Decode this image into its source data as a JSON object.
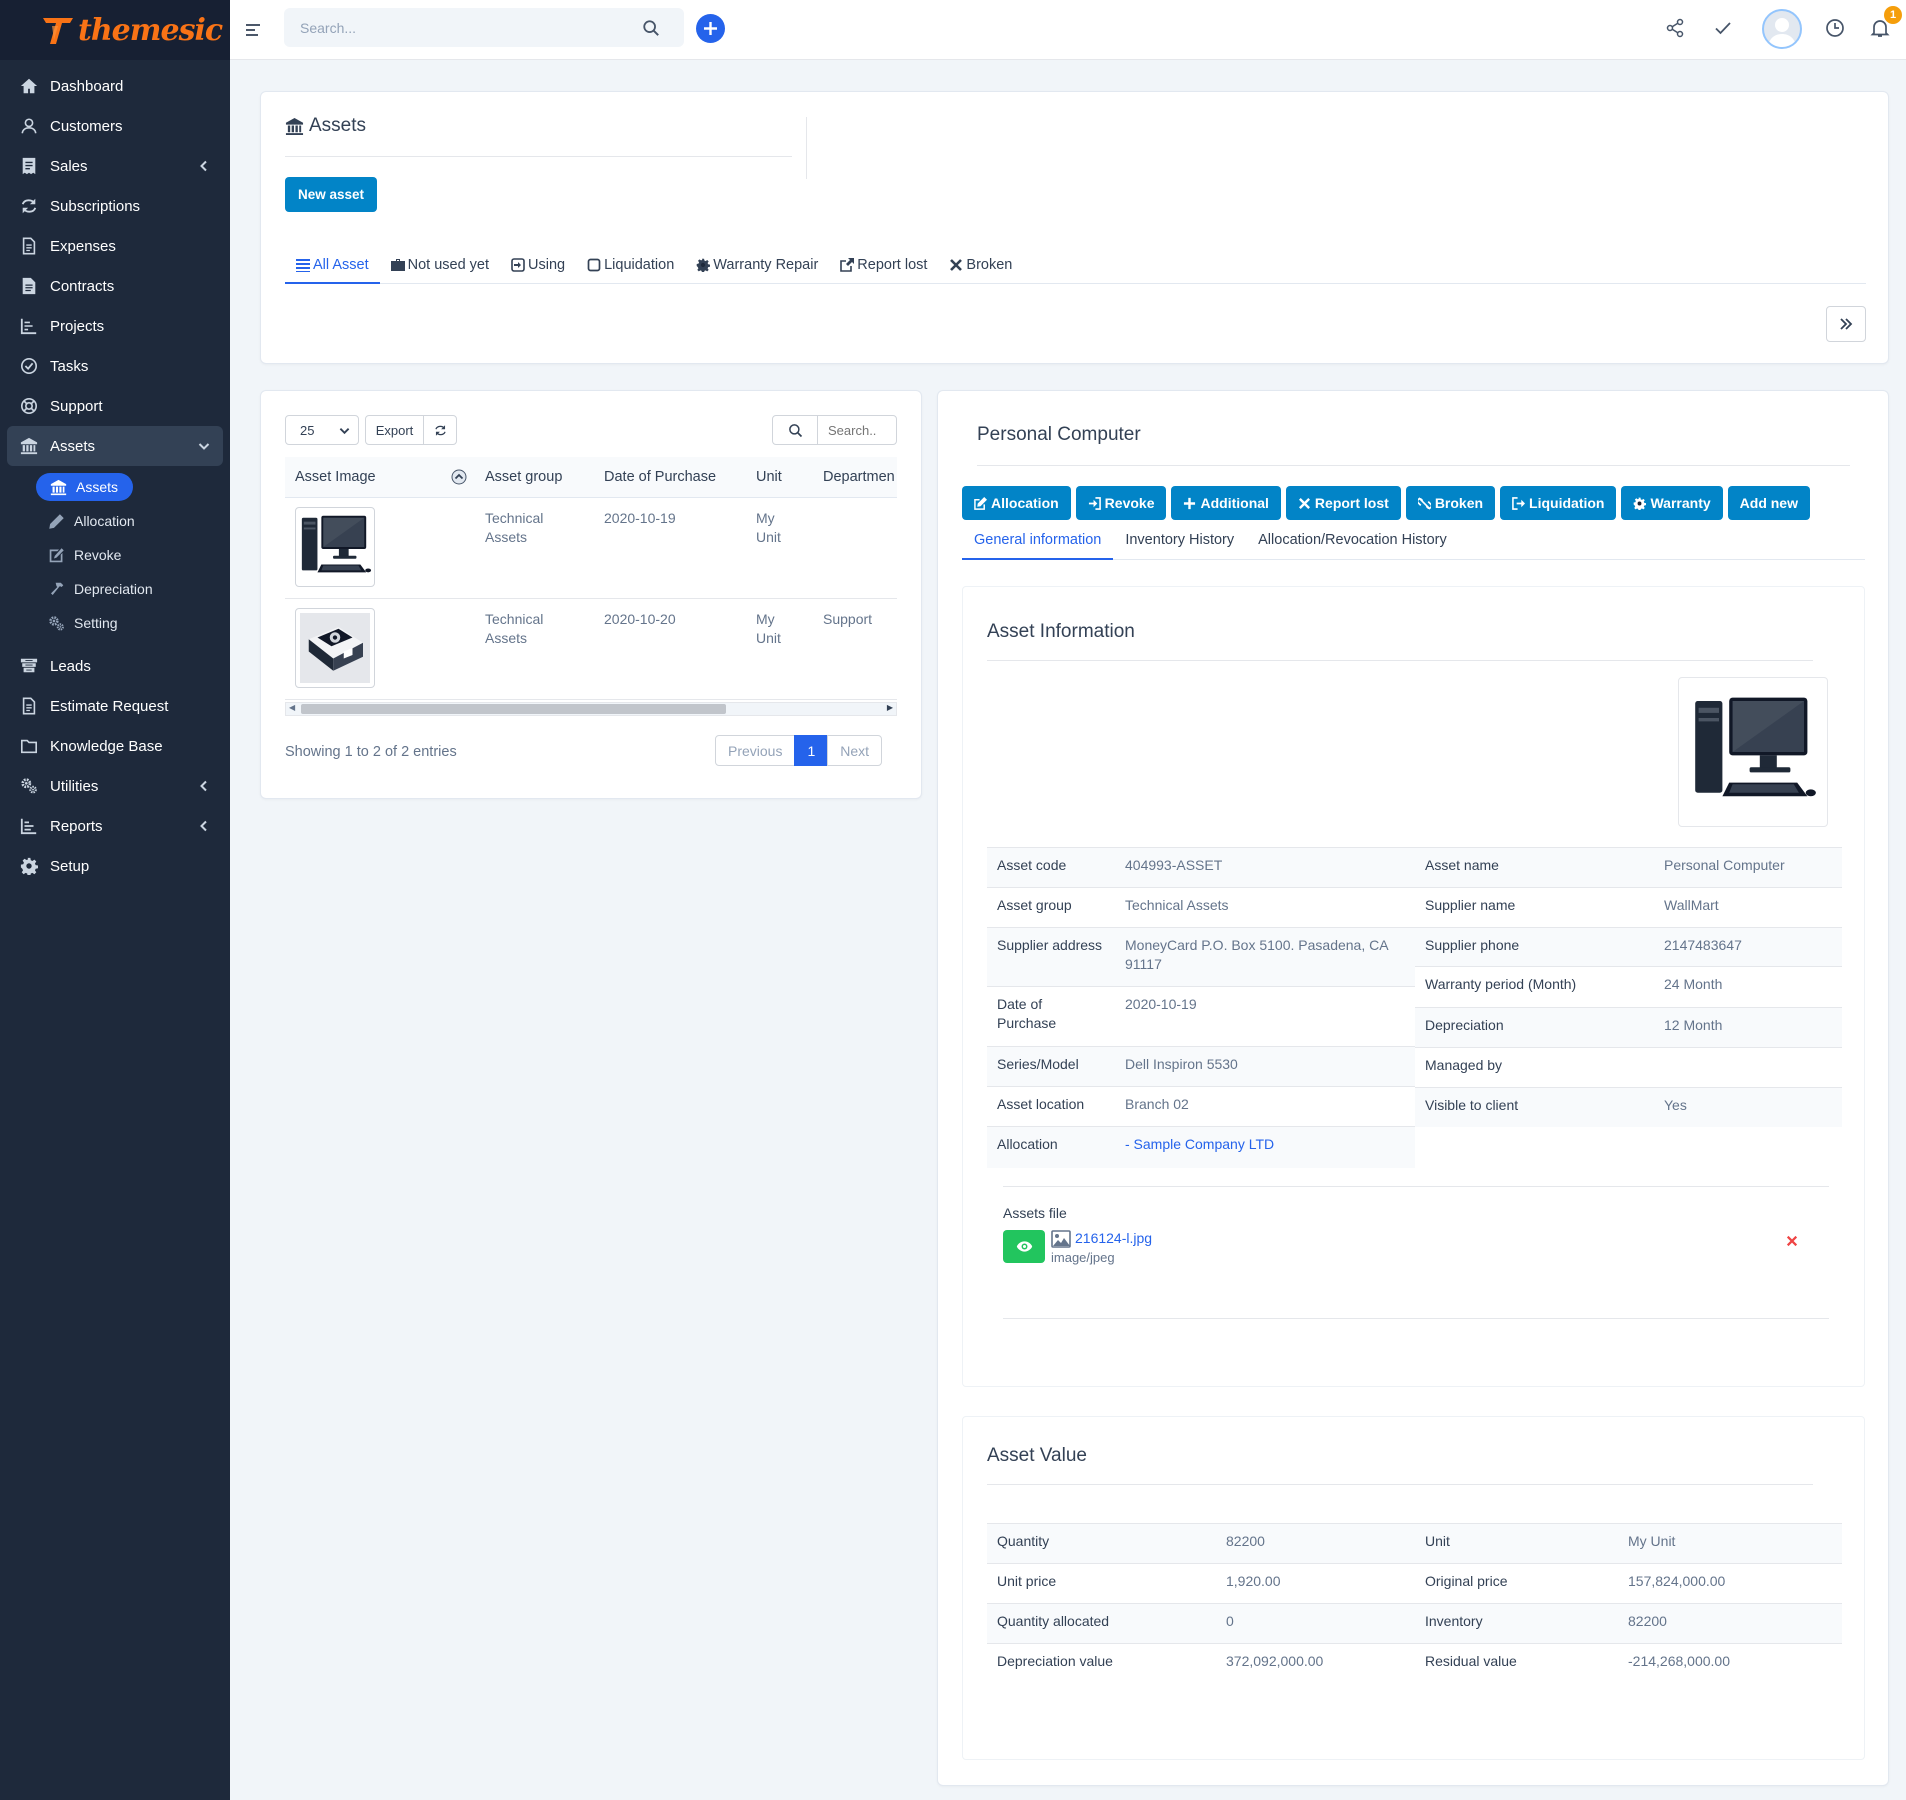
{
  "app": {
    "brand": "themesic",
    "brand_color": "#f97316",
    "accent": "#2563eb",
    "primary_button": "#0284c7"
  },
  "sidebar": {
    "items": [
      {
        "label": "Dashboard",
        "icon": "home-icon"
      },
      {
        "label": "Customers",
        "icon": "user-icon"
      },
      {
        "label": "Sales",
        "icon": "receipt-icon"
      },
      {
        "label": "Subscriptions",
        "icon": "refresh-icon"
      },
      {
        "label": "Expenses",
        "icon": "file-icon"
      },
      {
        "label": "Contracts",
        "icon": "document-icon"
      },
      {
        "label": "Projects",
        "icon": "chart-icon"
      },
      {
        "label": "Tasks",
        "icon": "check-circle-icon"
      },
      {
        "label": "Support",
        "icon": "lifebuoy-icon"
      },
      {
        "label": "Assets",
        "icon": "bank-icon"
      },
      {
        "label": "Leads",
        "icon": "funnel-icon"
      },
      {
        "label": "Estimate Request",
        "icon": "file-icon"
      },
      {
        "label": "Knowledge Base",
        "icon": "folder-icon"
      },
      {
        "label": "Utilities",
        "icon": "gears-icon"
      },
      {
        "label": "Reports",
        "icon": "chart-bars-icon"
      },
      {
        "label": "Setup",
        "icon": "gear-icon"
      }
    ],
    "assets_sub": [
      {
        "label": "Assets",
        "icon": "bank-icon"
      },
      {
        "label": "Allocation",
        "icon": "pencil-icon"
      },
      {
        "label": "Revoke",
        "icon": "edit-square-icon"
      },
      {
        "label": "Depreciation",
        "icon": "hammer-icon"
      },
      {
        "label": "Setting",
        "icon": "gears-icon"
      }
    ]
  },
  "header": {
    "search_placeholder": "Search...",
    "notification_count": "1"
  },
  "assets_panel": {
    "title": "Assets",
    "new_button": "New asset",
    "tabs": [
      "All Asset",
      "Not used yet",
      "Using",
      "Liquidation",
      "Warranty Repair",
      "Report lost",
      "Broken"
    ]
  },
  "list": {
    "page_size": "25",
    "export_label": "Export",
    "search_placeholder": "Search..",
    "columns": [
      "Asset Image",
      "Asset group",
      "Date of Purchase",
      "Unit",
      "Departmen"
    ],
    "rows": [
      {
        "group": "Technical Assets",
        "date": "2020-10-19",
        "unit": "My Unit",
        "department": ""
      },
      {
        "group": "Technical Assets",
        "date": "2020-10-20",
        "unit": "My Unit",
        "department": "Support"
      }
    ],
    "info": "Showing 1 to 2 of 2 entries",
    "pagination": {
      "previous": "Previous",
      "current": "1",
      "next": "Next"
    }
  },
  "detail": {
    "title": "Personal Computer",
    "actions": [
      "Allocation",
      "Revoke",
      "Additional",
      "Report lost",
      "Broken",
      "Liquidation",
      "Warranty",
      "Add new"
    ],
    "tabs": [
      "General information",
      "Inventory History",
      "Allocation/Revocation History"
    ],
    "asset_info_title": "Asset Information",
    "left": [
      {
        "label": "Asset code",
        "value": "404993-ASSET"
      },
      {
        "label": "Asset group",
        "value": "Technical Assets"
      },
      {
        "label": "Supplier address",
        "value": "MoneyCard P.O. Box 5100. Pasadena, CA 91117"
      },
      {
        "label": "Date of Purchase",
        "value": "2020-10-19"
      },
      {
        "label": "Series/Model",
        "value": "Dell Inspiron 5530"
      },
      {
        "label": "Asset location",
        "value": "Branch 02"
      },
      {
        "label": "Allocation",
        "value": "- Sample Company LTD"
      }
    ],
    "right": [
      {
        "label": "Asset name",
        "value": "Personal Computer"
      },
      {
        "label": "Supplier name",
        "value": "WallMart"
      },
      {
        "label": "Supplier phone",
        "value": "2147483647"
      },
      {
        "label": "Warranty period (Month)",
        "value": "24 Month"
      },
      {
        "label": "Depreciation",
        "value": "12 Month"
      },
      {
        "label": "Managed by",
        "value": ""
      },
      {
        "label": "Visible to client",
        "value": "Yes"
      }
    ],
    "files": {
      "title": "Assets file",
      "name": "216124-l.jpg",
      "type": "image/jpeg"
    },
    "value_title": "Asset Value",
    "values": [
      {
        "k1": "Quantity",
        "v1": "82200",
        "k2": "Unit",
        "v2": "My Unit"
      },
      {
        "k1": "Unit price",
        "v1": "1,920.00",
        "k2": "Original price",
        "v2": "157,824,000.00"
      },
      {
        "k1": "Quantity allocated",
        "v1": "0",
        "k2": "Inventory",
        "v2": "82200"
      },
      {
        "k1": "Depreciation value",
        "v1": "372,092,000.00",
        "k2": "Residual value",
        "v2": "-214,268,000.00"
      }
    ]
  }
}
